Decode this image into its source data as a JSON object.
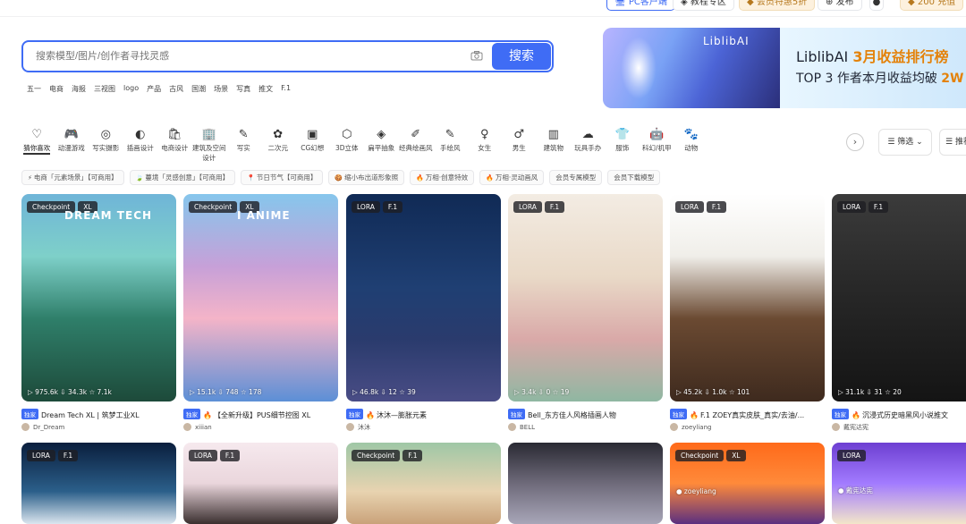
{
  "topbar": {
    "pc_client": "PC客户端",
    "tutorial": "教程专区",
    "vip": "会员特惠5折",
    "publish": "发布",
    "credits": "200 充值"
  },
  "search": {
    "placeholder": "搜索模型/图片/创作者寻找灵感",
    "button": "搜索"
  },
  "hot_tags": [
    "五一",
    "电商",
    "海报",
    "三视图",
    "logo",
    "产品",
    "古风",
    "国潮",
    "场景",
    "写真",
    "推文",
    "F.1"
  ],
  "banner": {
    "logo": "LiblibAI",
    "title_prefix": "LiblibAI ",
    "title_highlight": "3月收益排行榜",
    "sub_prefix": "TOP 3 作者本月收益均破 ",
    "sub_highlight": "2W"
  },
  "categories": [
    {
      "label": "猜你喜欢",
      "icon": "♡"
    },
    {
      "label": "动漫游戏",
      "icon": "🎮"
    },
    {
      "label": "写实摄影",
      "icon": "◎"
    },
    {
      "label": "插画设计",
      "icon": "◐"
    },
    {
      "label": "电商设计",
      "icon": "🛍"
    },
    {
      "label": "建筑及空间设计",
      "icon": "🏢"
    },
    {
      "label": "写实",
      "icon": "✎"
    },
    {
      "label": "二次元",
      "icon": "✿"
    },
    {
      "label": "CG幻想",
      "icon": "▣"
    },
    {
      "label": "3D立体",
      "icon": "⬡"
    },
    {
      "label": "扁平抽象",
      "icon": "◈"
    },
    {
      "label": "经典绘画风",
      "icon": "✐"
    },
    {
      "label": "手绘风",
      "icon": "✎"
    },
    {
      "label": "女生",
      "icon": "♀"
    },
    {
      "label": "男生",
      "icon": "♂"
    },
    {
      "label": "建筑物",
      "icon": "▥"
    },
    {
      "label": "玩具手办",
      "icon": "☁"
    },
    {
      "label": "服饰",
      "icon": "👕"
    },
    {
      "label": "科幻/机甲",
      "icon": "🤖"
    },
    {
      "label": "动物",
      "icon": "🐾"
    }
  ],
  "controls": {
    "more": "›",
    "filter": "筛选",
    "sort": "推荐"
  },
  "chips": [
    {
      "icon": "⚡",
      "label": "电商「元素场景」【可商用】"
    },
    {
      "icon": "🍃",
      "label": "蔓境「灵感创意」【可商用】"
    },
    {
      "icon": "📍",
      "label": "节日节气【可商用】"
    },
    {
      "icon": "🍪",
      "label": "缩小布出道形象照"
    },
    {
      "icon": "🔥",
      "label": "万相·创意特效"
    },
    {
      "icon": "🔥",
      "label": "万相·灵动画风"
    },
    {
      "icon": "",
      "label": "会员专属模型"
    },
    {
      "icon": "",
      "label": "会员下载模型"
    }
  ],
  "cards": [
    {
      "badge1": "Checkpoint",
      "badge2": "XL",
      "overlay": "DREAM TECH",
      "stats": "▷ 975.6k  ⇩ 34.3k  ☆ 7.1k",
      "title": "Dream Tech XL | 筑梦工业XL",
      "author": "Dr_Dream"
    },
    {
      "badge1": "Checkpoint",
      "badge2": "XL",
      "overlay": "I ANIME",
      "stats": "▷ 15.1k  ⇩ 748  ☆ 178",
      "title": "【全新升级】PUS细节控图 XL",
      "author": "xiiian"
    },
    {
      "badge1": "LORA",
      "badge2": "F.1",
      "overlay": "",
      "stats": "▷ 46.8k  ⇩ 12  ☆ 39",
      "title": "沐沐—膨胀元素",
      "author": "沐沐"
    },
    {
      "badge1": "LORA",
      "badge2": "F.1",
      "overlay": "",
      "stats": "▷ 3.4k  ⇩ 0  ☆ 19",
      "title": "Bell_东方佳人风格插画人物",
      "author": "BELL"
    },
    {
      "badge1": "LORA",
      "badge2": "F.1",
      "overlay": "",
      "stats": "▷ 45.2k  ⇩ 1.0k  ☆ 101",
      "title": "F.1 ZOEY真实皮肤_真实/去油/...",
      "author": "zoeyliang"
    },
    {
      "badge1": "LORA",
      "badge2": "F.1",
      "overlay": "",
      "stats": "▷ 31.1k  ⇩ 31  ☆ 20",
      "title": "沉浸式历史暗黑风小说推文",
      "author": "戴宪达宪"
    }
  ],
  "card_label": "独家",
  "row2": [
    {
      "badge1": "LORA",
      "badge2": "F.1"
    },
    {
      "badge1": "LORA",
      "badge2": "F.1"
    },
    {
      "badge1": "Checkpoint",
      "badge2": "F.1"
    },
    {
      "badge1": "",
      "badge2": ""
    },
    {
      "badge1": "Checkpoint",
      "badge2": "XL",
      "author": "zoeyliang"
    },
    {
      "badge1": "LORA",
      "badge2": "",
      "author": "戴宪达宪"
    }
  ]
}
